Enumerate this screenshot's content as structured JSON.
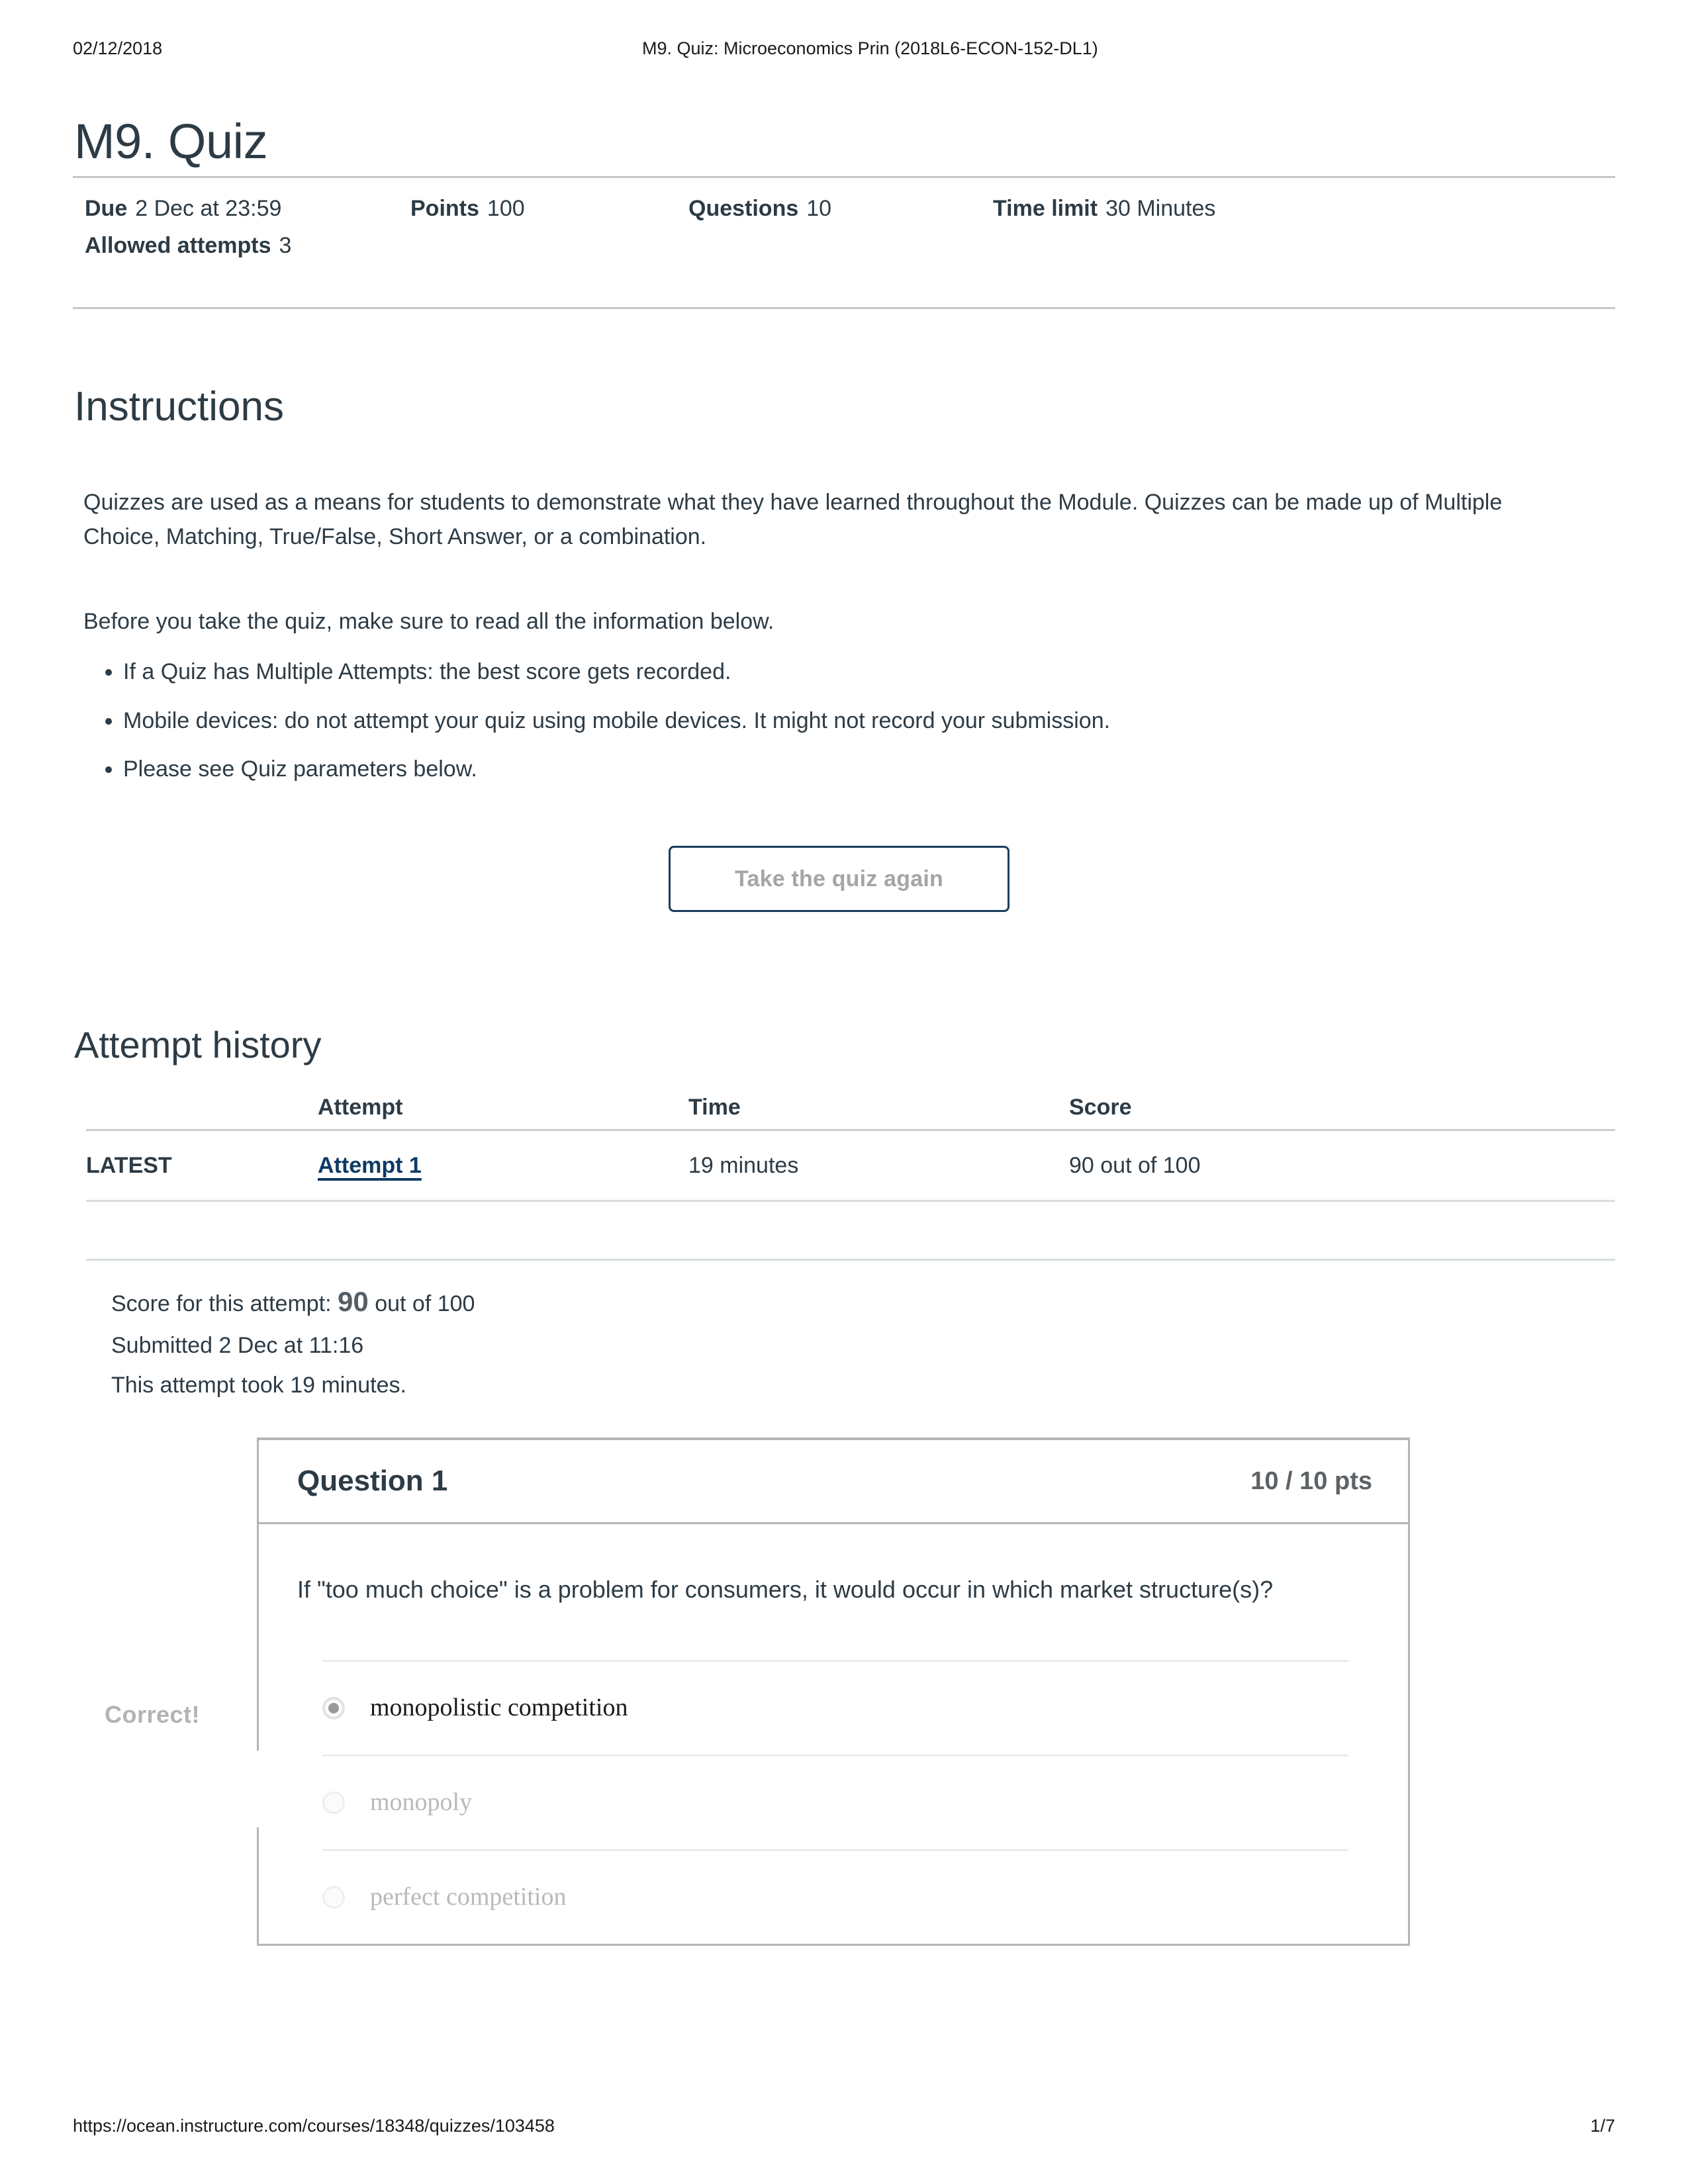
{
  "print_header": {
    "date": "02/12/2018",
    "title": "M9. Quiz: Microeconomics Prin (2018L6-ECON-152-DL1)"
  },
  "quiz": {
    "title": "M9. Quiz",
    "meta": {
      "due_label": "Due",
      "due_value": "2 Dec at 23:59",
      "points_label": "Points",
      "points_value": "100",
      "questions_label": "Questions",
      "questions_value": "10",
      "time_limit_label": "Time limit",
      "time_limit_value": "30 Minutes",
      "allowed_attempts_label": "Allowed attempts",
      "allowed_attempts_value": "3"
    }
  },
  "instructions": {
    "heading": "Instructions",
    "paragraph_1": "Quizzes are used as a means for students to demonstrate what they have learned throughout the Module. Quizzes can be made up of Multiple Choice, Matching, True/False, Short Answer, or a combination.",
    "paragraph_2": "Before you take the quiz, make sure to read all the information below.",
    "bullets": [
      "If a Quiz has Multiple Attempts: the best score gets recorded.",
      "Mobile devices: do not attempt your quiz using mobile devices. It might not record your submission.",
      "Please see Quiz parameters below."
    ]
  },
  "take_again_button": {
    "label": "Take the quiz again"
  },
  "attempt_history": {
    "heading": "Attempt history",
    "columns": [
      "",
      "Attempt",
      "Time",
      "Score"
    ],
    "rows": [
      {
        "badge": "LATEST",
        "attempt": "Attempt 1 ",
        "time": "19 minutes",
        "score": "90 out of 100"
      }
    ]
  },
  "attempt_summary": {
    "score_prefix": "Score for this attempt:",
    "score_value": "90",
    "score_suffix": "out of 100",
    "submitted": "Submitted 2 Dec at 11:16",
    "duration": "This attempt took 19 minutes."
  },
  "question": {
    "title": "Question 1",
    "points": "10 / 10 pts",
    "text": "If \"too much choice\" is a problem for consumers, it would occur in which market structure(s)?",
    "result_flag": "Correct!",
    "answers": [
      {
        "label": "monopolistic competition",
        "selected": true
      },
      {
        "label": "monopoly",
        "selected": false
      },
      {
        "label": "perfect competition",
        "selected": false
      }
    ]
  },
  "print_footer": {
    "url": "https://ocean.instructure.com/courses/18348/quizzes/103458",
    "page": "1/7"
  },
  "colors": {
    "text": "#2d3b45",
    "link": "#0e3a63",
    "rule": "#c7c7c7",
    "muted": "#b3b3b3",
    "button_border": "#1b3d5e"
  }
}
